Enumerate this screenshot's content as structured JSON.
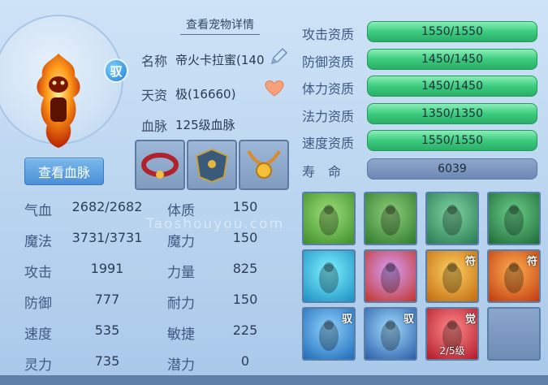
{
  "pet": {
    "detail_link": "查看宠物详情",
    "ride_badge": "驭",
    "name_label": "名称",
    "name_value": "帝火卡拉蜜(140",
    "talent_label": "天资",
    "talent_value": "极(16660)",
    "bloodline_label": "血脉",
    "bloodline_value": "125级血脉",
    "view_bloodline_button": "查看血脉"
  },
  "stats": [
    {
      "label": "气血",
      "value": "2682/2682",
      "label2": "体质",
      "value2": "150"
    },
    {
      "label": "魔法",
      "value": "3731/3731",
      "label2": "魔力",
      "value2": "150"
    },
    {
      "label": "攻击",
      "value": "1991",
      "label2": "力量",
      "value2": "825"
    },
    {
      "label": "防御",
      "value": "777",
      "label2": "耐力",
      "value2": "150"
    },
    {
      "label": "速度",
      "value": "535",
      "label2": "敏捷",
      "value2": "225"
    },
    {
      "label": "灵力",
      "value": "735",
      "label2": "潜力",
      "value2": "0"
    }
  ],
  "aptitudes": [
    {
      "label": "攻击资质",
      "value": "1550/1550"
    },
    {
      "label": "防御资质",
      "value": "1450/1450"
    },
    {
      "label": "体力资质",
      "value": "1450/1450"
    },
    {
      "label": "法力资质",
      "value": "1350/1350"
    },
    {
      "label": "速度资质",
      "value": "1550/1550"
    }
  ],
  "life": {
    "label": "寿　命",
    "value": "6039"
  },
  "skills": [
    {
      "icon": "green-strength-icon"
    },
    {
      "icon": "green-shadow-icon"
    },
    {
      "icon": "green-figure-icon"
    },
    {
      "icon": "green-warrior-icon"
    },
    {
      "icon": "blue-flame-icon"
    },
    {
      "icon": "red-talisman-icon"
    },
    {
      "icon": "gold-figure-icon",
      "tag": "符"
    },
    {
      "icon": "fire-sword-icon",
      "tag": "符"
    },
    {
      "icon": "blue-strike-icon",
      "tag": "驭"
    },
    {
      "icon": "blue-sword-icon",
      "tag": "驭"
    },
    {
      "icon": "red-awaken-icon",
      "tag": "觉",
      "level": "2/5级"
    },
    {
      "icon": "empty-slot",
      "tag": ""
    }
  ],
  "watermark": "Taoshouyou.com"
}
